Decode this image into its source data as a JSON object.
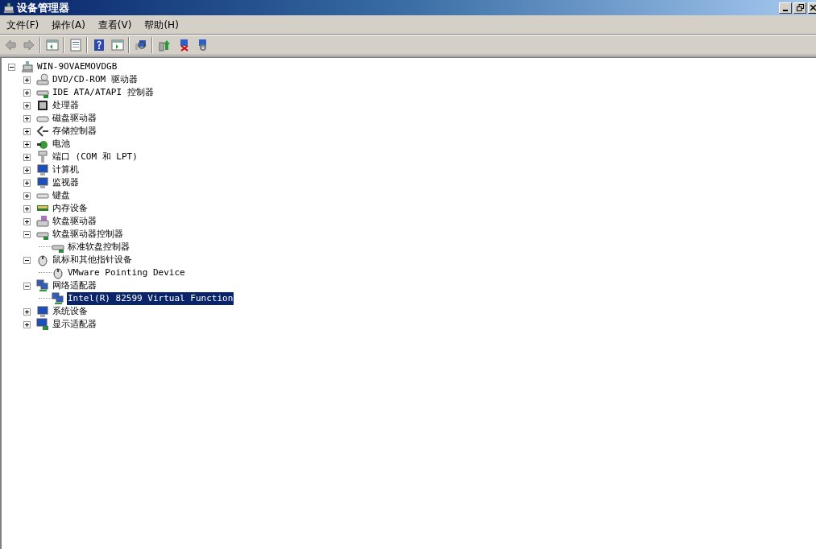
{
  "window": {
    "title": "设备管理器"
  },
  "menu": [
    {
      "label": "文件(F)"
    },
    {
      "label": "操作(A)"
    },
    {
      "label": "查看(V)"
    },
    {
      "label": "帮助(H)"
    }
  ],
  "toolbar": [
    {
      "kind": "back",
      "disabled": true
    },
    {
      "kind": "forward",
      "disabled": true
    },
    {
      "kind": "sep"
    },
    {
      "kind": "tree",
      "disabled": false
    },
    {
      "kind": "sep"
    },
    {
      "kind": "properties",
      "disabled": false
    },
    {
      "kind": "sep"
    },
    {
      "kind": "help",
      "disabled": false
    },
    {
      "kind": "pane",
      "disabled": false
    },
    {
      "kind": "sep"
    },
    {
      "kind": "scan",
      "disabled": false
    },
    {
      "kind": "sep"
    },
    {
      "kind": "update",
      "disabled": false
    },
    {
      "kind": "disable",
      "disabled": false
    },
    {
      "kind": "uninstall",
      "disabled": false
    }
  ],
  "tree": {
    "label": "WIN-9OVAEMOVDGB",
    "kind": "computer",
    "expanded": true,
    "selected": false,
    "children": [
      {
        "label": "DVD/CD-ROM 驱动器",
        "kind": "disc",
        "expanded": false,
        "selected": false
      },
      {
        "label": "IDE ATA/ATAPI 控制器",
        "kind": "ide",
        "expanded": false,
        "selected": false
      },
      {
        "label": "处理器",
        "kind": "cpu",
        "expanded": false,
        "selected": false
      },
      {
        "label": "磁盘驱动器",
        "kind": "disk",
        "expanded": false,
        "selected": false
      },
      {
        "label": "存储控制器",
        "kind": "storage",
        "expanded": false,
        "selected": false
      },
      {
        "label": "电池",
        "kind": "battery",
        "expanded": false,
        "selected": false
      },
      {
        "label": "端口 (COM 和 LPT)",
        "kind": "port",
        "expanded": false,
        "selected": false
      },
      {
        "label": "计算机",
        "kind": "monitor",
        "expanded": false,
        "selected": false
      },
      {
        "label": "监视器",
        "kind": "monitor",
        "expanded": false,
        "selected": false
      },
      {
        "label": "键盘",
        "kind": "keyboard",
        "expanded": false,
        "selected": false
      },
      {
        "label": "内存设备",
        "kind": "memory",
        "expanded": false,
        "selected": false
      },
      {
        "label": "软盘驱动器",
        "kind": "floppy",
        "expanded": false,
        "selected": false
      },
      {
        "label": "软盘驱动器控制器",
        "kind": "ide",
        "expanded": true,
        "selected": false,
        "children": [
          {
            "label": "标准软盘控制器",
            "kind": "ide",
            "selected": false
          }
        ]
      },
      {
        "label": "鼠标和其他指针设备",
        "kind": "mouse",
        "expanded": true,
        "selected": false,
        "children": [
          {
            "label": "VMware Pointing Device",
            "kind": "mouse",
            "selected": false
          }
        ]
      },
      {
        "label": "网络适配器",
        "kind": "network",
        "expanded": true,
        "selected": false,
        "children": [
          {
            "label": "Intel(R) 82599 Virtual Function",
            "kind": "network",
            "selected": true
          }
        ]
      },
      {
        "label": "系统设备",
        "kind": "monitor",
        "expanded": false,
        "selected": false
      },
      {
        "label": "显示适配器",
        "kind": "display",
        "expanded": false,
        "selected": false
      }
    ]
  }
}
